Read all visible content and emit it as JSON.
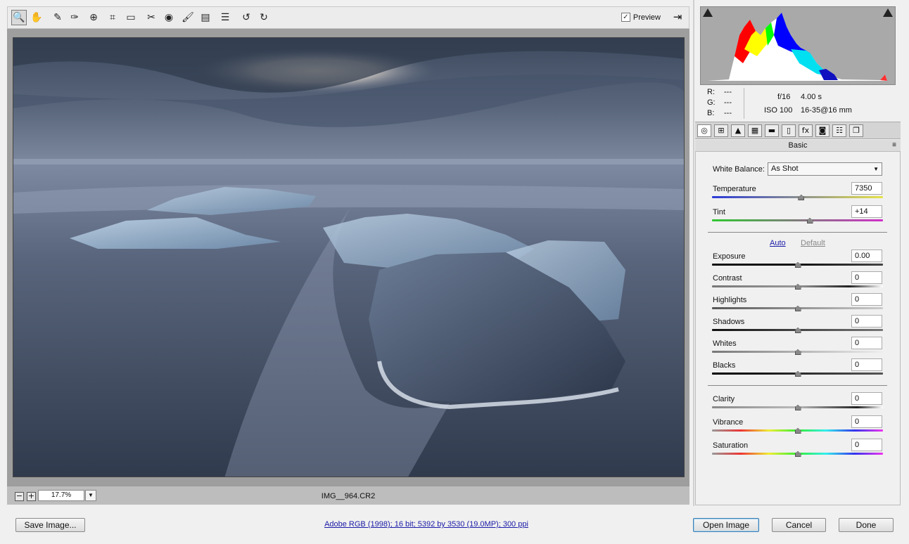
{
  "toolbar": {
    "tools": [
      {
        "name": "zoom-tool",
        "icon": "zoom-icon",
        "glyph": "🔍"
      },
      {
        "name": "hand-tool",
        "icon": "hand-icon",
        "glyph": "✋"
      },
      {
        "name": "white-balance-tool",
        "icon": "eyedropper-icon",
        "glyph": "✎"
      },
      {
        "name": "color-sampler-tool",
        "icon": "color-sampler-icon",
        "glyph": "✑"
      },
      {
        "name": "targeted-adjustment-tool",
        "icon": "target-icon",
        "glyph": "⊕"
      },
      {
        "name": "crop-tool",
        "icon": "crop-icon",
        "glyph": "⌗"
      },
      {
        "name": "straighten-tool",
        "icon": "level-icon",
        "glyph": "▭"
      },
      {
        "name": "spot-removal-tool",
        "icon": "spot-removal-icon",
        "glyph": "✂"
      },
      {
        "name": "red-eye-tool",
        "icon": "eye-icon",
        "glyph": "◉"
      },
      {
        "name": "adjustment-brush-tool",
        "icon": "brush-icon",
        "glyph": "🖌"
      },
      {
        "name": "graduated-filter-tool",
        "icon": "gradient-icon",
        "glyph": "▤"
      },
      {
        "name": "preferences-tool",
        "icon": "list-icon",
        "glyph": "☰"
      },
      {
        "name": "rotate-left-tool",
        "icon": "rotate-ccw-icon",
        "glyph": "↺"
      },
      {
        "name": "rotate-right-tool",
        "icon": "rotate-cw-icon",
        "glyph": "↻"
      }
    ],
    "preview_label": "Preview",
    "preview_checked": "✓",
    "fullscreen_glyph": "⇥"
  },
  "image": {
    "zoom_minus": "−",
    "zoom_plus": "+",
    "zoom_value": "17.7%",
    "zoom_dropdown": "▼",
    "filename": "IMG__964.CR2"
  },
  "info": {
    "r_label": "R:",
    "r_value": "---",
    "g_label": "G:",
    "g_value": "---",
    "b_label": "B:",
    "b_value": "---",
    "aperture": "f/16",
    "shutter": "4.00 s",
    "iso": "ISO 100",
    "lens": "16-35@16 mm"
  },
  "panel_tabs": [
    {
      "name": "tab-basic",
      "glyph": "◎"
    },
    {
      "name": "tab-tone-curve",
      "glyph": "⊞"
    },
    {
      "name": "tab-detail",
      "glyph": "▲"
    },
    {
      "name": "tab-hsl",
      "glyph": "▦"
    },
    {
      "name": "tab-split-toning",
      "glyph": "▬"
    },
    {
      "name": "tab-lens-corrections",
      "glyph": "▯"
    },
    {
      "name": "tab-effects",
      "glyph": "fx"
    },
    {
      "name": "tab-camera-calibration",
      "glyph": "◙"
    },
    {
      "name": "tab-presets",
      "glyph": "☷"
    },
    {
      "name": "tab-snapshots",
      "glyph": "❐"
    }
  ],
  "panel": {
    "title": "Basic",
    "menu_glyph": "≡",
    "white_balance_label": "White Balance:",
    "white_balance_value": "As Shot",
    "dropdown_arrow": "▼",
    "auto_label": "Auto",
    "default_label": "Default"
  },
  "sliders": {
    "temperature": {
      "label": "Temperature",
      "value": "7350",
      "level": 0.52
    },
    "tint": {
      "label": "Tint",
      "value": "+14",
      "level": 0.57
    },
    "exposure": {
      "label": "Exposure",
      "value": "0.00",
      "level": 0.5
    },
    "contrast": {
      "label": "Contrast",
      "value": "0",
      "level": 0.5
    },
    "highlights": {
      "label": "Highlights",
      "value": "0",
      "level": 0.5
    },
    "shadows": {
      "label": "Shadows",
      "value": "0",
      "level": 0.5
    },
    "whites": {
      "label": "Whites",
      "value": "0",
      "level": 0.5
    },
    "blacks": {
      "label": "Blacks",
      "value": "0",
      "level": 0.5
    },
    "clarity": {
      "label": "Clarity",
      "value": "0",
      "level": 0.5
    },
    "vibrance": {
      "label": "Vibrance",
      "value": "0",
      "level": 0.5
    },
    "saturation": {
      "label": "Saturation",
      "value": "0",
      "level": 0.5
    }
  },
  "footer": {
    "save_label": "Save Image...",
    "workflow_text": "Adobe RGB (1998); 16 bit; 5392 by 3530 (19.0MP); 300 ppi",
    "open_label": "Open Image",
    "cancel_label": "Cancel",
    "done_label": "Done"
  }
}
